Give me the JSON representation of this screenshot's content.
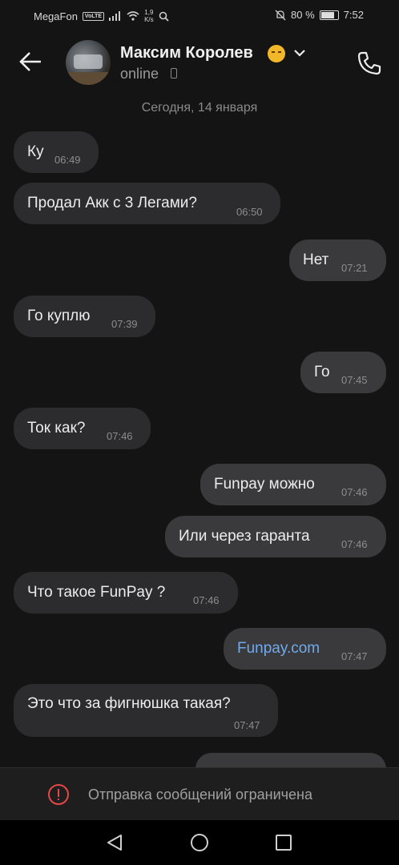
{
  "status_bar": {
    "carrier": "MegaFon",
    "volte": "VoLTE",
    "speed_value": "1,9",
    "speed_unit": "K/s",
    "battery": "80 %",
    "time": "7:52"
  },
  "header": {
    "name": "Максим Королев",
    "status": "online",
    "emoji_icon": "sleepy-face-emoji"
  },
  "date_separator": "Сегодня, 14 января",
  "messages": [
    {
      "text": "Ку",
      "time": "06:49",
      "dir": "in"
    },
    {
      "text": "Продал Акк с 3 Легами?",
      "time": "06:50",
      "dir": "in"
    },
    {
      "text": "Нет",
      "time": "07:21",
      "dir": "out"
    },
    {
      "text": "Го куплю",
      "time": "07:39",
      "dir": "in"
    },
    {
      "text": "Го",
      "time": "07:45",
      "dir": "out"
    },
    {
      "text": "Ток как?",
      "time": "07:46",
      "dir": "in"
    },
    {
      "text": "Funpay можно",
      "time": "07:46",
      "dir": "out"
    },
    {
      "text": "Или через гаранта",
      "time": "07:46",
      "dir": "out"
    },
    {
      "text": "Что такое FunPay ?",
      "time": "07:46",
      "dir": "in"
    },
    {
      "text": "Funpay.com",
      "time": "07:47",
      "dir": "out"
    },
    {
      "text": "Это что за фигнюшка такая?",
      "time": "07:47",
      "dir": "in"
    }
  ],
  "restriction_text": "Отправка сообщений ограничена",
  "colors": {
    "background": "#141414",
    "bubble_in": "#2c2c2e",
    "bubble_out": "#3a3a3c",
    "link": "#71aaeb",
    "warning": "#e64646"
  }
}
